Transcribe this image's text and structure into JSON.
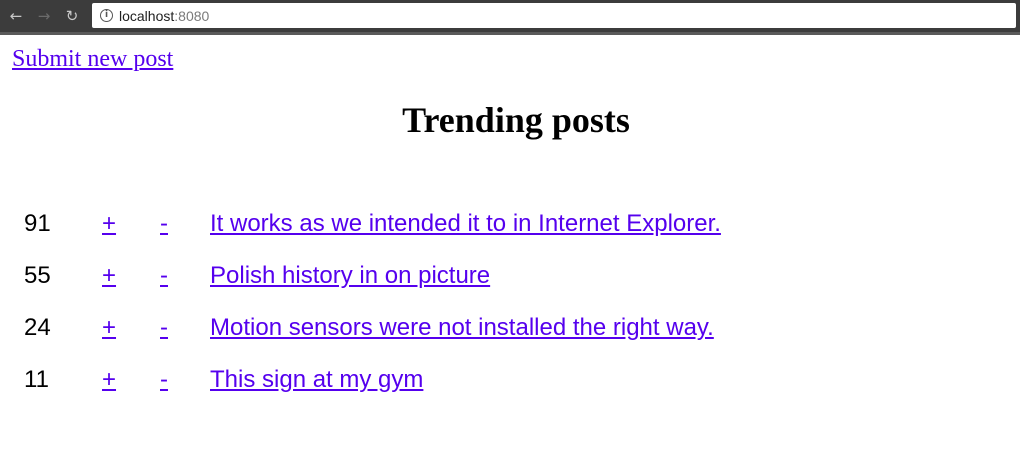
{
  "browser": {
    "url_host": "localhost",
    "url_port": ":8080"
  },
  "page": {
    "submit_link": "Submit new post",
    "title": "Trending posts",
    "upvote_label": "+",
    "downvote_label": "-",
    "posts": [
      {
        "score": "91",
        "title": "It works as we intended it to in Internet Explorer."
      },
      {
        "score": "55",
        "title": "Polish history in on picture"
      },
      {
        "score": "24",
        "title": "Motion sensors were not installed the right way."
      },
      {
        "score": "11",
        "title": "This sign at my gym"
      }
    ]
  },
  "colors": {
    "link": "#5500ee",
    "toolbar": "#3c3c3c"
  }
}
